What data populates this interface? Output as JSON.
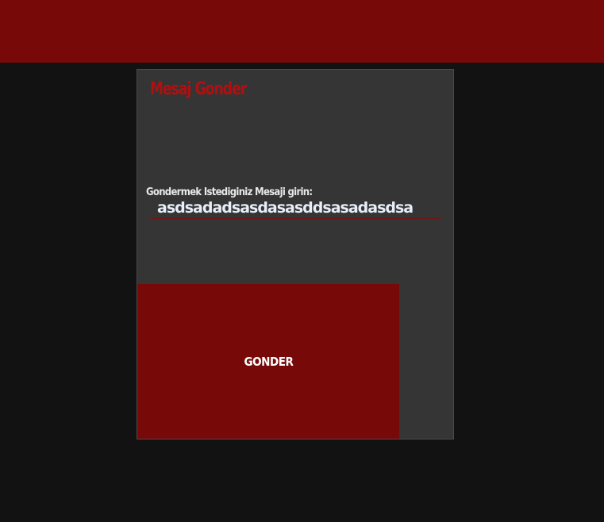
{
  "form": {
    "title": "Mesaj Gonder",
    "message_label": "Gondermek Istediginiz Mesaji girin:",
    "message_value": "asdsadadsasdasasddsasadasdsa",
    "submit_label": "GONDER"
  },
  "colors": {
    "topbar": "#780909",
    "background": "#121212",
    "card": "#353535",
    "title": "#b01010",
    "button": "#780909"
  }
}
